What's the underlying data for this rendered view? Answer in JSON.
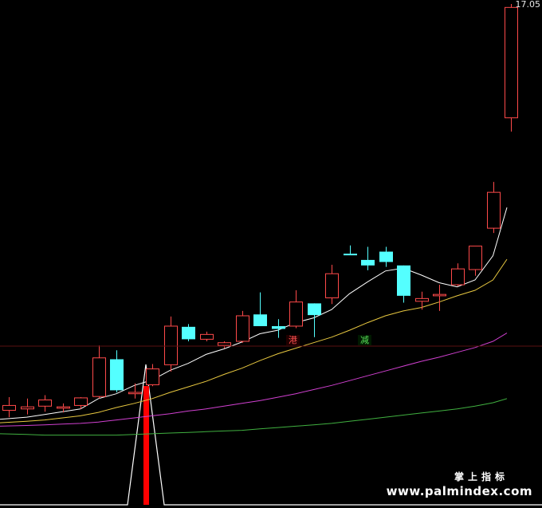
{
  "chart_data": [
    {
      "type": "candlestick",
      "title": "",
      "last_price_label": "17.05",
      "candles": [
        {
          "i": 0,
          "open": 11.16,
          "high": 11.35,
          "low": 11.06,
          "close": 11.23
        },
        {
          "i": 1,
          "open": 11.18,
          "high": 11.33,
          "low": 11.1,
          "close": 11.21
        },
        {
          "i": 2,
          "open": 11.22,
          "high": 11.38,
          "low": 11.14,
          "close": 11.31
        },
        {
          "i": 3,
          "open": 11.19,
          "high": 11.26,
          "low": 11.13,
          "close": 11.21
        },
        {
          "i": 4,
          "open": 11.23,
          "high": 11.35,
          "low": 11.18,
          "close": 11.34
        },
        {
          "i": 5,
          "open": 11.36,
          "high": 12.1,
          "low": 11.33,
          "close": 11.92
        },
        {
          "i": 6,
          "open": 11.9,
          "high": 12.03,
          "low": 11.42,
          "close": 11.45
        },
        {
          "i": 7,
          "open": 11.4,
          "high": 11.55,
          "low": 11.33,
          "close": 11.42
        },
        {
          "i": 8,
          "open": 11.53,
          "high": 11.83,
          "low": 11.51,
          "close": 11.76
        },
        {
          "i": 9,
          "open": 11.82,
          "high": 12.52,
          "low": 11.72,
          "close": 12.38
        },
        {
          "i": 10,
          "open": 12.37,
          "high": 12.41,
          "low": 12.16,
          "close": 12.19
        },
        {
          "i": 11,
          "open": 12.19,
          "high": 12.3,
          "low": 12.16,
          "close": 12.26
        },
        {
          "i": 12,
          "open": 12.1,
          "high": 12.16,
          "low": 12.06,
          "close": 12.14
        },
        {
          "i": 13,
          "open": 12.16,
          "high": 12.6,
          "low": 12.14,
          "close": 12.53
        },
        {
          "i": 14,
          "open": 12.55,
          "high": 12.87,
          "low": 12.38,
          "close": 12.38
        },
        {
          "i": 15,
          "open": 12.38,
          "high": 12.48,
          "low": 12.21,
          "close": 12.34
        },
        {
          "i": 16,
          "open": 12.38,
          "high": 12.9,
          "low": 12.35,
          "close": 12.73
        },
        {
          "i": 17,
          "open": 12.71,
          "high": 12.71,
          "low": 12.22,
          "close": 12.54
        },
        {
          "i": 18,
          "open": 12.79,
          "high": 13.27,
          "low": 12.7,
          "close": 13.14
        },
        {
          "i": 19,
          "open": 13.43,
          "high": 13.55,
          "low": 13.41,
          "close": 13.41
        },
        {
          "i": 20,
          "open": 13.34,
          "high": 13.53,
          "low": 13.19,
          "close": 13.26
        },
        {
          "i": 21,
          "open": 13.46,
          "high": 13.53,
          "low": 13.24,
          "close": 13.31
        },
        {
          "i": 22,
          "open": 13.26,
          "high": 13.26,
          "low": 12.72,
          "close": 12.82
        },
        {
          "i": 23,
          "open": 12.74,
          "high": 12.88,
          "low": 12.62,
          "close": 12.78
        },
        {
          "i": 24,
          "open": 12.82,
          "high": 12.98,
          "low": 12.6,
          "close": 12.84
        },
        {
          "i": 25,
          "open": 12.98,
          "high": 13.29,
          "low": 12.96,
          "close": 13.21
        },
        {
          "i": 26,
          "open": 13.2,
          "high": 13.54,
          "low": 13.11,
          "close": 13.54
        },
        {
          "i": 27,
          "open": 13.8,
          "high": 14.47,
          "low": 13.73,
          "close": 14.32
        },
        {
          "i": 28,
          "open": 15.4,
          "high": 17.05,
          "low": 15.2,
          "close": 17.0
        }
      ],
      "moving_averages": [
        {
          "name": "MA5",
          "color": "#ffffff",
          "values": [
            11.03,
            11.06,
            11.1,
            11.14,
            11.18,
            11.33,
            11.4,
            11.52,
            11.6,
            11.74,
            11.84,
            11.97,
            12.05,
            12.15,
            12.27,
            12.32,
            12.43,
            12.5,
            12.62,
            12.85,
            13.02,
            13.18,
            13.22,
            13.12,
            13.01,
            12.95,
            13.05,
            13.4,
            14.1
          ]
        },
        {
          "name": "MA10",
          "color": "#e8c840",
          "values": [
            10.98,
            11.0,
            11.02,
            11.05,
            11.08,
            11.13,
            11.2,
            11.26,
            11.33,
            11.42,
            11.5,
            11.58,
            11.68,
            11.77,
            11.88,
            11.98,
            12.06,
            12.14,
            12.22,
            12.32,
            12.43,
            12.53,
            12.6,
            12.65,
            12.73,
            12.82,
            12.9,
            13.05,
            13.35
          ]
        },
        {
          "name": "MA20",
          "color": "#d040d0",
          "values": [
            10.93,
            10.94,
            10.95,
            10.96,
            10.97,
            10.99,
            11.02,
            11.05,
            11.08,
            11.11,
            11.15,
            11.18,
            11.22,
            11.26,
            11.3,
            11.35,
            11.4,
            11.46,
            11.52,
            11.59,
            11.66,
            11.73,
            11.8,
            11.87,
            11.93,
            12.0,
            12.07,
            12.16,
            12.28
          ]
        },
        {
          "name": "MA60",
          "color": "#40b040",
          "values": [
            10.82,
            10.81,
            10.8,
            10.8,
            10.8,
            10.8,
            10.8,
            10.81,
            10.82,
            10.83,
            10.84,
            10.85,
            10.86,
            10.87,
            10.89,
            10.91,
            10.93,
            10.95,
            10.97,
            11.0,
            11.03,
            11.06,
            11.09,
            11.12,
            11.15,
            11.18,
            11.22,
            11.27,
            11.33
          ]
        }
      ],
      "signals": [
        {
          "index": 16,
          "label": "港",
          "color": "#ff5050"
        },
        {
          "index": 20,
          "label": "减",
          "color": "#58e058"
        }
      ]
    },
    {
      "type": "indicator",
      "title": "",
      "bars": [
        {
          "index": 8,
          "value": 1
        }
      ],
      "spike_indices": [
        8
      ]
    }
  ],
  "watermark": {
    "line1": "掌上指标",
    "line2": "www.palmindex.com"
  }
}
